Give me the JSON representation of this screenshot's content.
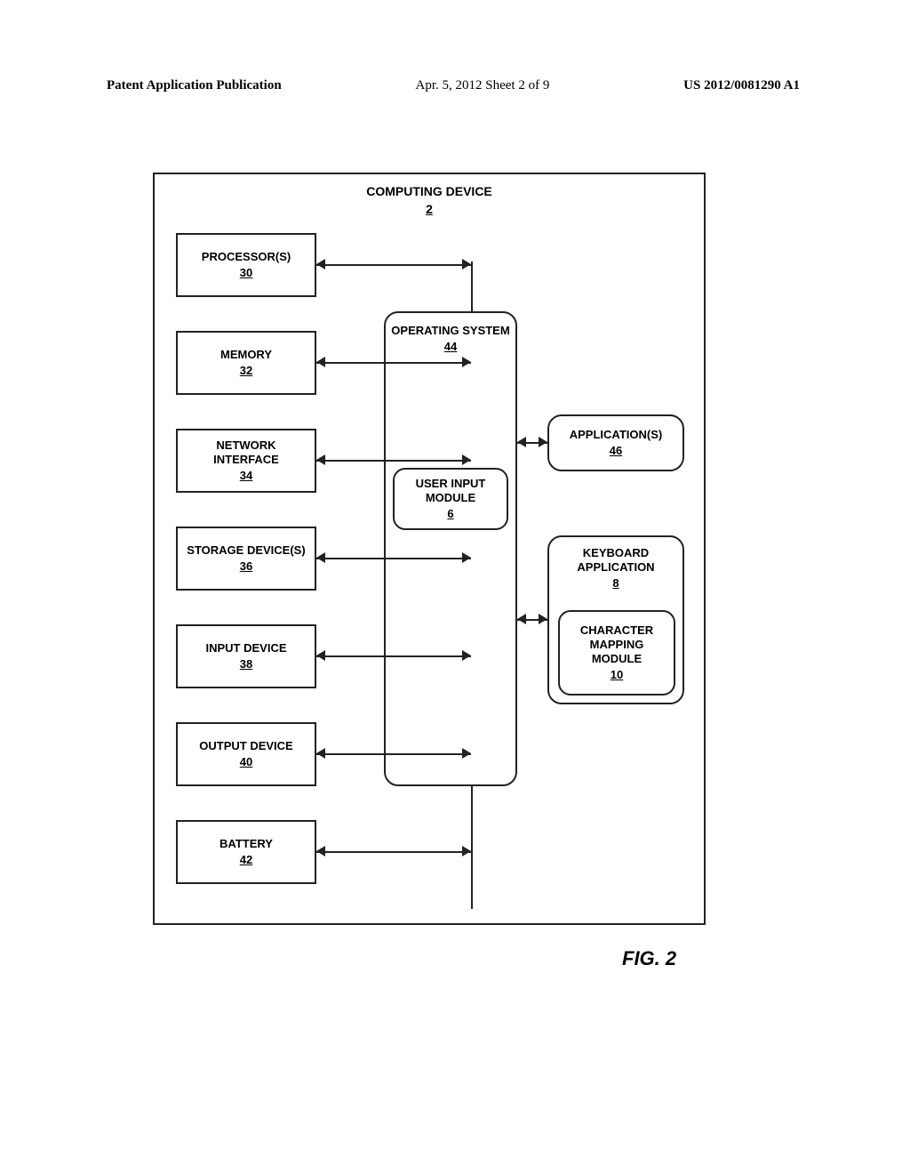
{
  "header": {
    "left": "Patent Application Publication",
    "mid": "Apr. 5, 2012  Sheet 2 of 9",
    "right": "US 2012/0081290 A1"
  },
  "outer": {
    "title": "COMPUTING DEVICE",
    "num": "2"
  },
  "left_blocks": [
    {
      "label": "PROCESSOR(S)",
      "num": "30"
    },
    {
      "label": "MEMORY",
      "num": "32"
    },
    {
      "label": "NETWORK INTERFACE",
      "num": "34"
    },
    {
      "label": "STORAGE DEVICE(S)",
      "num": "36"
    },
    {
      "label": "INPUT DEVICE",
      "num": "38"
    },
    {
      "label": "OUTPUT DEVICE",
      "num": "40"
    },
    {
      "label": "BATTERY",
      "num": "42"
    }
  ],
  "os": {
    "label": "OPERATING SYSTEM",
    "num": "44"
  },
  "user_input": {
    "label": "USER INPUT MODULE",
    "num": "6"
  },
  "apps": {
    "label": "APPLICATION(S)",
    "num": "46"
  },
  "kbd": {
    "label": "KEYBOARD APPLICATION",
    "num": "8"
  },
  "charmap": {
    "label": "CHARACTER MAPPING MODULE",
    "num": "10"
  },
  "figure": {
    "label": "FIG. 2"
  },
  "chart_data": {
    "type": "diagram",
    "title": "COMPUTING DEVICE 2 — block diagram",
    "nodes": [
      {
        "id": "device",
        "label": "COMPUTING DEVICE",
        "ref": "2",
        "container": true
      },
      {
        "id": "proc",
        "label": "PROCESSOR(S)",
        "ref": "30"
      },
      {
        "id": "mem",
        "label": "MEMORY",
        "ref": "32"
      },
      {
        "id": "net",
        "label": "NETWORK INTERFACE",
        "ref": "34"
      },
      {
        "id": "stor",
        "label": "STORAGE DEVICE(S)",
        "ref": "36"
      },
      {
        "id": "in",
        "label": "INPUT DEVICE",
        "ref": "38"
      },
      {
        "id": "out",
        "label": "OUTPUT DEVICE",
        "ref": "40"
      },
      {
        "id": "bat",
        "label": "BATTERY",
        "ref": "42"
      },
      {
        "id": "os",
        "label": "OPERATING SYSTEM",
        "ref": "44",
        "contains": [
          "uim"
        ]
      },
      {
        "id": "uim",
        "label": "USER INPUT MODULE",
        "ref": "6"
      },
      {
        "id": "apps",
        "label": "APPLICATION(S)",
        "ref": "46"
      },
      {
        "id": "kbd",
        "label": "KEYBOARD APPLICATION",
        "ref": "8",
        "contains": [
          "cmm"
        ]
      },
      {
        "id": "cmm",
        "label": "CHARACTER MAPPING MODULE",
        "ref": "10"
      }
    ],
    "edges": [
      {
        "from": "proc",
        "to": "bus",
        "dir": "both"
      },
      {
        "from": "mem",
        "to": "bus",
        "dir": "both"
      },
      {
        "from": "net",
        "to": "bus",
        "dir": "both"
      },
      {
        "from": "stor",
        "to": "bus",
        "dir": "both"
      },
      {
        "from": "in",
        "to": "bus",
        "dir": "both"
      },
      {
        "from": "out",
        "to": "bus",
        "dir": "both"
      },
      {
        "from": "bat",
        "to": "bus",
        "dir": "both"
      },
      {
        "from": "bus",
        "to": "os",
        "dir": "to"
      },
      {
        "from": "os",
        "to": "apps",
        "dir": "both"
      },
      {
        "from": "os",
        "to": "kbd",
        "dir": "both"
      }
    ]
  }
}
